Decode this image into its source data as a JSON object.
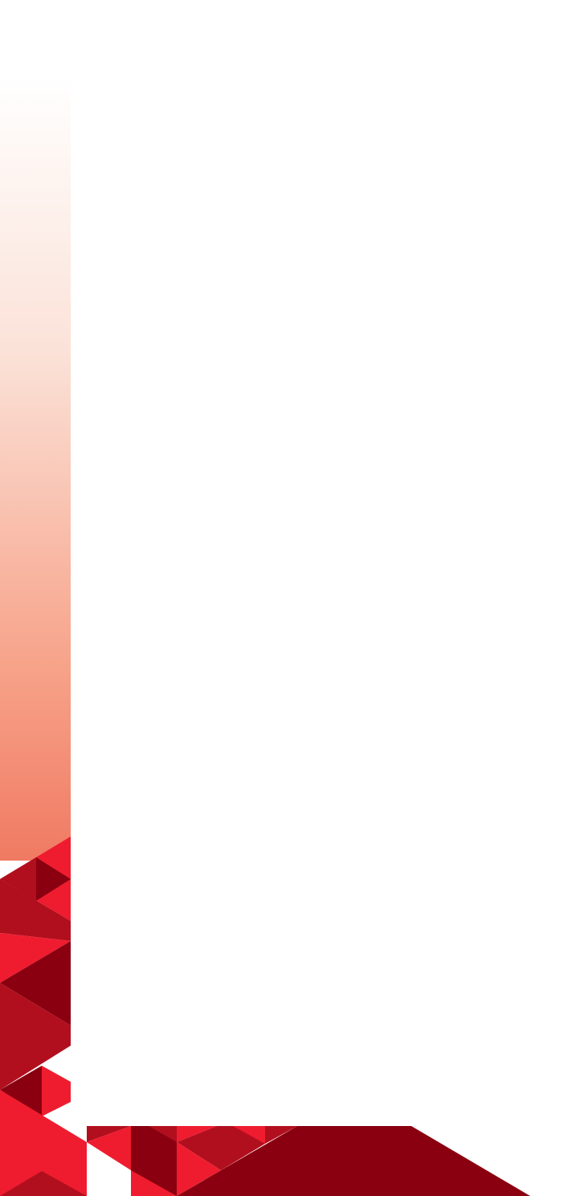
{
  "theme": {
    "background": "#ffffff",
    "gradient_top": "#ffffff",
    "gradient_bottom": "#f07a62",
    "red_bright": "#ef1c2f",
    "red_mid": "#b20f1e",
    "red_dark": "#8a0010"
  }
}
